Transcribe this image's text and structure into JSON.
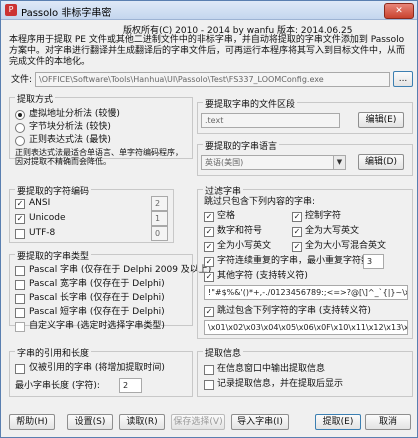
{
  "window": {
    "title": "Passolo 非标字串密",
    "close_label": "✕"
  },
  "copyright": "版权所有(C) 2010 - 2014 by wanfu   版本: 2014.06.25",
  "description": "本程序用于提取 PE 文件或其他二进制文件中的非标字串，并自动将提取的字串文件添加到 Passolo 方案中。对字串进行翻译并生成翻译后的字串文件后，可再运行本程序将其写入到目标文件中，从而完成文件的本地化。",
  "file": {
    "label": "文件:",
    "value": "\\OFFICE\\Software\\Tools\\Hanhua\\UI\\Passolo\\Test\\FS337_LOOMConfig.exe",
    "browse": "..."
  },
  "extract_method": {
    "title": "提取方式",
    "options": [
      "虚拟地址分析法 (较慢)",
      "字节块分析法 (较快)",
      "正则表达式法 (最快)"
    ],
    "selected": 0,
    "note": "正则表达式法最适合单语言、单字符编码程序，因对提取不精确而会降低。"
  },
  "sections": {
    "title": "要提取字串的文件区段",
    "value": ".text",
    "edit": "编辑(E)"
  },
  "language": {
    "title": "要提取的字串语言",
    "value": "英语(美国)",
    "edit": "编辑(D)"
  },
  "encoding": {
    "title": "要提取的字符编码",
    "items": [
      {
        "label": "ANSI",
        "checked": true,
        "value": "2"
      },
      {
        "label": "Unicode",
        "checked": true,
        "value": "1"
      },
      {
        "label": "UTF-8",
        "checked": false,
        "value": "0"
      }
    ]
  },
  "string_types": {
    "title": "要提取的字串类型",
    "items": [
      "Pascal 字串 (仅存在于 Delphi 2009 及以上)",
      "Pascal 宽字串 (仅存在于 Delphi)",
      "Pascal 长字串 (仅存在于 Delphi)",
      "Pascal 短字串 (仅存在于 Delphi)",
      "自定义字串 (选定时选择字串类型)"
    ]
  },
  "filter": {
    "title": "过滤字串",
    "skip_label": "跳过只包含下列内容的字串:",
    "opts": [
      {
        "label": "空格",
        "checked": true
      },
      {
        "label": "控制字符",
        "checked": true
      },
      {
        "label": "数字和符号",
        "checked": true
      },
      {
        "label": "全为大写英文",
        "checked": true
      },
      {
        "label": "全为小写英文",
        "checked": true
      },
      {
        "label": "全为大小写混合英文",
        "checked": true
      }
    ],
    "min_len_label": "字符连续重复的字串，最小重复字符数:",
    "min_len_value": "3",
    "other_label": "其他字符 (支持转义符)",
    "other_value": "!\"#$%&'()*+,-./0123456789:;<=>?@[\\]^_`{|}~\\x7F\\u201A\\u201E",
    "skip_string_label": "跳过包含下列字符的字串 (支持转义符)",
    "skip_string_value": "\\x01\\x02\\x03\\x04\\x05\\x06\\x0F\\x10\\x11\\x12\\x13\\x14\\x"
  },
  "reference": {
    "title": "字串的引用和长度",
    "only_ref_label": "仅被引用的字串 (将增加提取时间)",
    "min_len_label": "最小字串长度 (字符):",
    "min_len_value": "2"
  },
  "extract_info": {
    "title": "提取信息",
    "opt1": "在信息窗口中输出提取信息",
    "opt2": "记录提取信息，并在提取后显示"
  },
  "buttons": {
    "help": "帮助(H)",
    "settings": "设置(S)",
    "read": "读取(R)",
    "save": "保存选择(V)",
    "import": "导入字串(I)",
    "extract": "提取(E)",
    "cancel": "取消"
  }
}
